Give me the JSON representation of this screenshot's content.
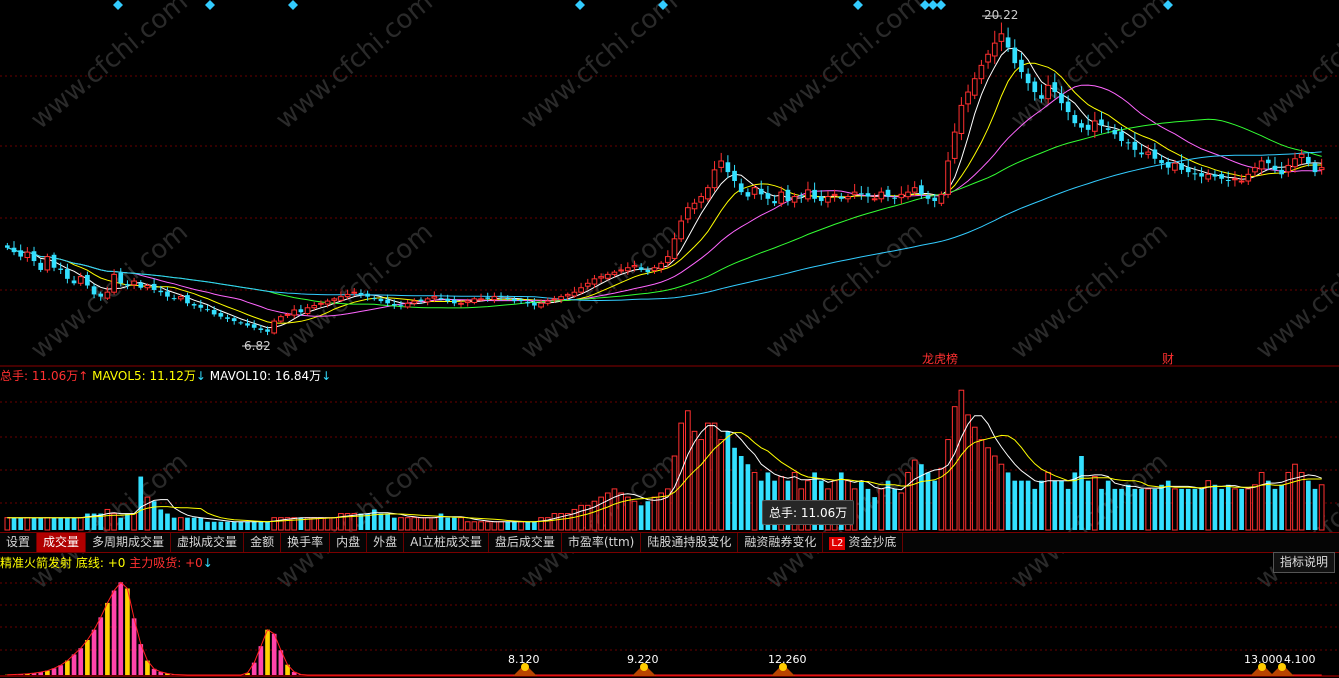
{
  "chart_data": [
    {
      "type": "candlestick",
      "title": "",
      "price_high": 20.22,
      "price_low": 6.82,
      "markers": [
        "龙虎榜",
        "财"
      ],
      "colors": {
        "up": "#ff3030",
        "down": "#33e0ff",
        "ma5": "#ffffff",
        "ma10": "#ffff00",
        "ma20": "#ff66ff",
        "ma60": "#33ff33",
        "ma120": "#33ccff"
      },
      "values": [
        10.6,
        10.4,
        10.2,
        10.4,
        10.0,
        9.6,
        10.2,
        9.7,
        9.6,
        9.2,
        9.0,
        9.3,
        8.9,
        8.5,
        8.4,
        8.6,
        9.4,
        9.0,
        8.9,
        9.1,
        8.8,
        8.9,
        8.7,
        8.6,
        8.4,
        8.3,
        8.4,
        8.1,
        8.0,
        7.9,
        7.8,
        7.6,
        7.5,
        7.4,
        7.3,
        7.2,
        7.1,
        7.0,
        6.9,
        6.82,
        7.3,
        7.5,
        7.6,
        7.8,
        7.7,
        7.9,
        8.0,
        8.1,
        8.2,
        8.3,
        8.4,
        8.5,
        8.6,
        8.5,
        8.4,
        8.3,
        8.2,
        8.1,
        8.0,
        8.0,
        8.1,
        8.2,
        8.2,
        8.3,
        8.4,
        8.3,
        8.2,
        8.1,
        8.1,
        8.2,
        8.3,
        8.3,
        8.3,
        8.4,
        8.4,
        8.3,
        8.2,
        8.2,
        8.1,
        8.0,
        8.1,
        8.2,
        8.3,
        8.4,
        8.5,
        8.6,
        8.8,
        9.0,
        9.2,
        9.3,
        9.4,
        9.5,
        9.6,
        9.7,
        9.8,
        9.6,
        9.5,
        9.7,
        9.9,
        10.2,
        11.0,
        11.8,
        12.4,
        12.6,
        12.9,
        13.3,
        14.1,
        14.5,
        14.0,
        13.6,
        13.1,
        12.9,
        13.3,
        13.0,
        12.8,
        12.6,
        13.1,
        12.7,
        12.9,
        12.9,
        13.2,
        12.8,
        12.7,
        12.9,
        13.0,
        12.8,
        12.9,
        13.1,
        13.0,
        12.9,
        12.8,
        13.1,
        12.9,
        12.8,
        13.0,
        13.1,
        13.3,
        13.0,
        12.8,
        12.7,
        13.0,
        14.5,
        15.8,
        17.0,
        17.6,
        18.2,
        18.8,
        19.3,
        19.8,
        20.22,
        19.6,
        18.9,
        18.5,
        18.0,
        17.6,
        17.3,
        17.9,
        17.6,
        17.1,
        16.7,
        16.2,
        16.0,
        15.9,
        16.3,
        16.1,
        15.9,
        15.7,
        15.4,
        15.3,
        15.0,
        14.8,
        14.9,
        14.6,
        14.4,
        14.2,
        14.4,
        14.1,
        14.0,
        13.9,
        13.8,
        13.9,
        13.8,
        13.7,
        13.6,
        13.7,
        13.6,
        13.9,
        14.2,
        14.5,
        14.4,
        14.1,
        13.9,
        14.3,
        14.6,
        14.8,
        14.4,
        14.0,
        14.2
      ]
    },
    {
      "type": "bar",
      "title": "",
      "legend": "总手",
      "values": [
        3,
        3,
        3,
        3,
        3,
        3,
        3,
        3,
        3,
        3,
        3,
        3,
        4,
        4,
        4,
        5,
        4,
        3,
        4,
        4,
        13,
        8,
        7,
        5,
        4,
        3,
        3,
        3,
        3,
        3,
        2,
        2,
        2,
        2,
        2,
        2,
        2,
        2,
        2,
        2,
        3,
        3,
        3,
        3,
        3,
        3,
        3,
        3,
        3,
        3,
        4,
        4,
        4,
        4,
        4,
        5,
        4,
        4,
        3,
        3,
        3,
        3,
        3,
        3,
        3,
        4,
        3,
        3,
        3,
        2,
        2,
        2,
        2,
        2,
        2,
        2,
        2,
        2,
        2,
        2,
        3,
        3,
        4,
        4,
        4,
        5,
        6,
        6,
        7,
        8,
        9,
        10,
        9,
        8,
        7,
        6,
        7,
        8,
        9,
        10,
        18,
        26,
        29,
        24,
        22,
        26,
        26,
        22,
        24,
        20,
        18,
        16,
        14,
        12,
        14,
        12,
        13,
        12,
        14,
        10,
        12,
        14,
        12,
        10,
        12,
        14,
        12,
        10,
        12,
        10,
        8,
        10,
        12,
        10,
        9,
        14,
        17,
        16,
        14,
        12,
        15,
        22,
        30,
        34,
        28,
        25,
        22,
        20,
        18,
        16,
        14,
        12,
        12,
        12,
        10,
        12,
        14,
        12,
        12,
        10,
        14,
        18,
        12,
        13,
        10,
        12,
        10,
        10,
        11,
        10,
        10,
        10,
        10,
        11,
        12,
        10,
        10,
        10,
        10,
        10,
        12,
        11,
        10,
        11,
        10,
        10,
        10,
        11,
        14,
        12,
        10,
        11,
        14,
        16,
        14,
        12,
        10,
        11
      ]
    },
    {
      "type": "area",
      "title": "",
      "values": [
        0.3,
        0.5,
        0.8,
        1.2,
        1.8,
        2.8,
        4.2,
        6.5,
        9.5,
        14.0,
        20.0,
        26.0,
        34.0,
        44.0,
        56.0,
        70.0,
        82.0,
        90.0,
        84.0,
        55.0,
        30.0,
        14.0,
        6.0,
        3.0,
        1.5,
        0.5,
        0.2,
        0,
        0,
        0,
        0,
        0,
        0,
        0,
        0,
        0,
        2,
        12,
        28,
        44,
        40,
        24,
        10,
        3,
        0.5,
        0,
        0,
        0,
        0,
        0,
        0,
        0,
        0,
        0,
        0,
        0,
        0,
        0,
        0,
        0,
        0,
        0,
        0,
        0,
        0,
        0,
        0,
        0,
        0,
        0,
        0,
        0,
        0,
        0,
        0,
        0,
        0,
        0,
        0,
        0,
        0,
        0,
        0,
        0,
        0,
        0,
        0,
        0,
        0,
        0,
        0,
        0,
        0,
        0,
        0,
        0,
        0,
        0,
        0,
        0,
        0,
        0,
        0,
        0,
        0,
        0,
        0,
        0,
        0,
        0,
        0,
        0,
        0,
        0,
        0,
        0,
        0,
        0,
        0,
        0,
        0,
        0,
        0,
        0,
        0,
        0,
        0,
        0,
        0,
        0,
        0,
        0,
        0,
        0,
        0,
        0,
        0,
        0,
        0,
        0,
        0,
        0,
        0,
        0,
        0,
        0,
        0,
        0,
        0,
        0,
        0,
        0,
        0,
        0,
        0,
        0,
        0,
        0,
        0,
        0,
        0,
        0,
        0,
        0,
        0,
        0,
        0,
        0,
        0,
        0,
        0,
        0,
        0,
        0,
        0,
        0,
        0,
        0,
        0,
        0,
        0,
        0,
        0,
        0,
        0,
        0,
        0,
        0,
        0,
        0,
        0,
        0,
        0,
        0,
        0,
        0,
        0,
        0
      ]
    }
  ],
  "volume_legend": {
    "total_label": "总手: 11.06万",
    "total_arrow": "↑",
    "mavol5_label": "MAVOL5: 11.12万",
    "mavol5_arrow": "↓",
    "mavol10_label": "MAVOL10: 16.84万",
    "mavol10_arrow": "↓"
  },
  "indicator_legend": {
    "name": "精准火箭发射",
    "bottom_label": "底线: +0",
    "main_label": "主力吸货: +0",
    "arrow": "↓"
  },
  "tooltip": "总手: 11.06万",
  "price_high_label": "20.22",
  "price_low_label": "6.82",
  "marker_labels": [
    "龙虎榜",
    "财"
  ],
  "toolbar_tabs": [
    {
      "label": "设置"
    },
    {
      "label": "成交量",
      "active": true
    },
    {
      "label": "多周期成交量"
    },
    {
      "label": "虚拟成交量"
    },
    {
      "label": "金额"
    },
    {
      "label": "换手率"
    },
    {
      "label": "内盘"
    },
    {
      "label": "外盘"
    },
    {
      "label": "AI立桩成交量"
    },
    {
      "label": "盘后成交量"
    },
    {
      "label": "市盈率(ttm)"
    },
    {
      "label": "陆股通持股变化"
    },
    {
      "label": "融资融券变化"
    },
    {
      "label": "资金抄底",
      "badge": "L2"
    }
  ],
  "explain_button": "指标说明",
  "bottom_labels": [
    "8.120",
    "9.220",
    "12.260",
    "13.000",
    "4.100"
  ],
  "watermark": "www.cfchi.com"
}
